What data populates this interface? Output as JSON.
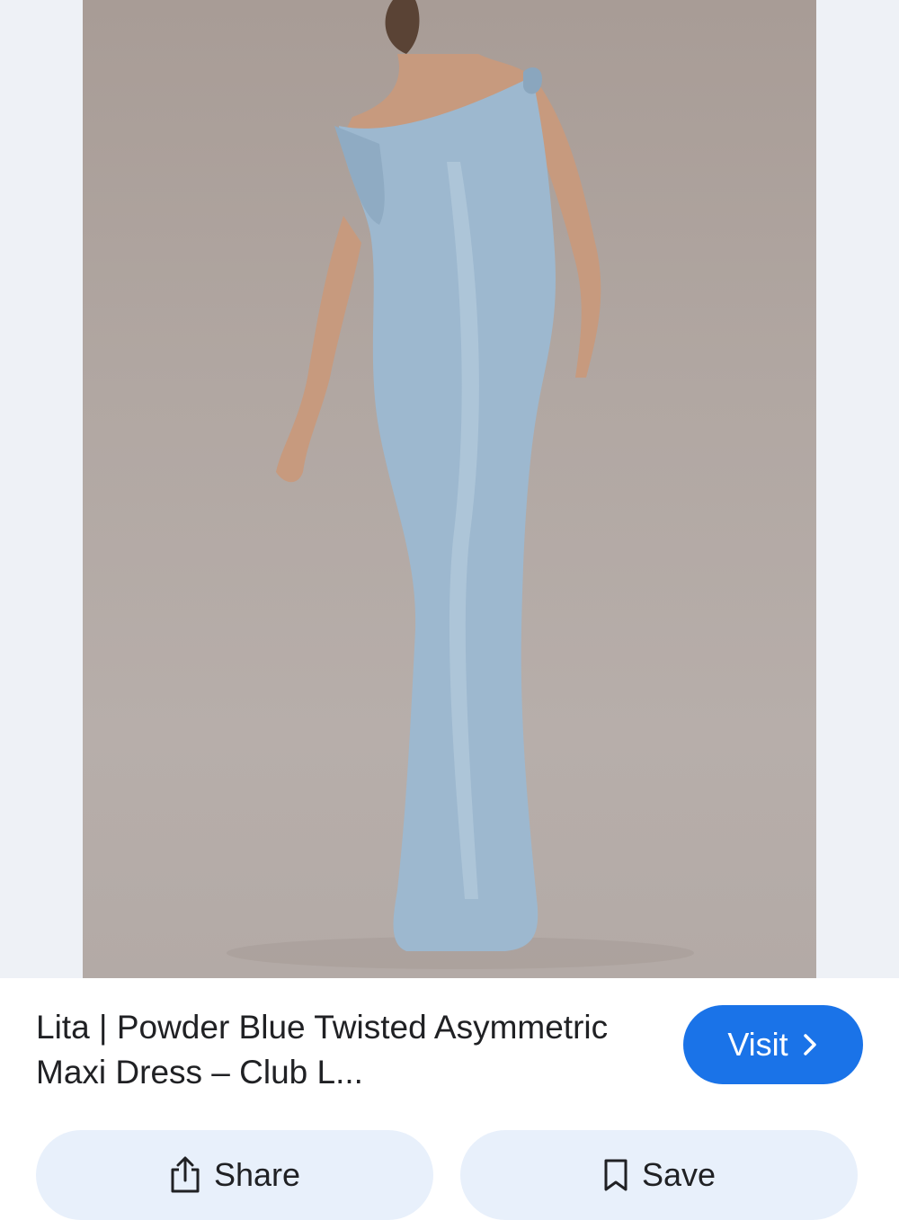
{
  "result": {
    "title": "Lita | Powder Blue Twisted Asymmetric Maxi Dress – Club L...",
    "image_subject": "model in powder blue one-shoulder maxi dress"
  },
  "actions": {
    "visit_label": "Visit",
    "share_label": "Share",
    "save_label": "Save"
  },
  "colors": {
    "accent": "#1a73e8",
    "chip_bg": "#e8f0fb",
    "dress": "#9db8cf",
    "backdrop": "#b1a7a2"
  },
  "icons": {
    "visit": "chevron-right-icon",
    "share": "share-icon",
    "save": "bookmark-icon"
  }
}
